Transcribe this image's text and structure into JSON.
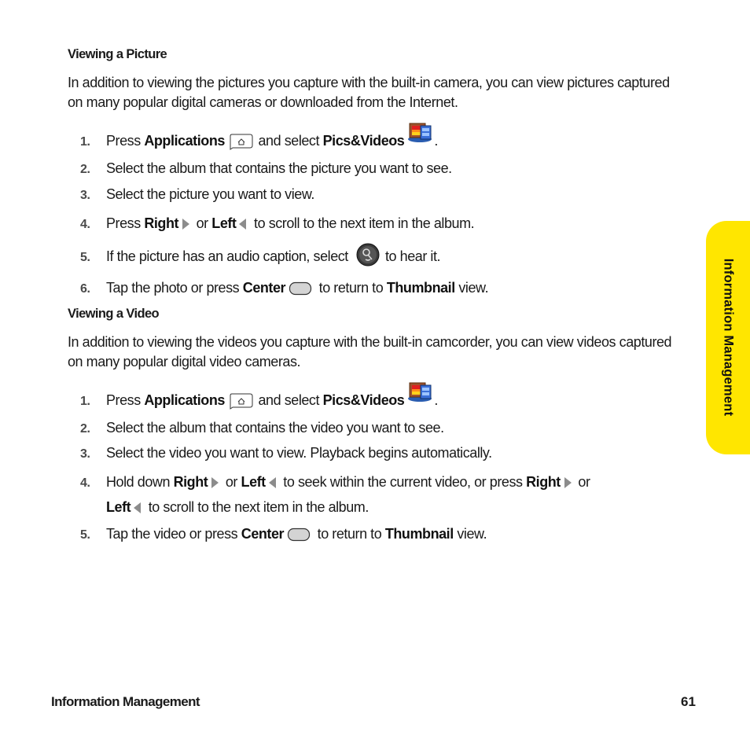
{
  "section_picture": {
    "title": "Viewing a Picture",
    "intro": "In addition to viewing the pictures you capture with the built-in camera, you can view pictures captured on many popular digital cameras or downloaded from the Internet.",
    "steps": [
      {
        "num": "1.",
        "t1": "Press ",
        "b1": "Applications",
        "t2": " and select ",
        "b2": "Pics&Videos",
        "t3": "."
      },
      {
        "num": "2.",
        "text": "Select the album that contains the picture you want to see."
      },
      {
        "num": "3.",
        "text": "Select the picture you want to view."
      },
      {
        "num": "4.",
        "t1": "Press ",
        "b1": "Right",
        "t2": " or ",
        "b2": "Left",
        "t3": " to scroll to the next item in the album."
      },
      {
        "num": "5.",
        "t1": "If the picture has an audio caption, select ",
        "t2": " to hear it."
      },
      {
        "num": "6.",
        "t1": "Tap the photo or press ",
        "b1": "Center",
        "t2": " to return to ",
        "b2": "Thumbnail",
        "t3": " view."
      }
    ]
  },
  "section_video": {
    "title": "Viewing a Video",
    "intro": "In addition to viewing the videos you capture with the built-in camcorder, you can view videos captured on many popular digital video cameras.",
    "steps": [
      {
        "num": "1.",
        "t1": "Press ",
        "b1": "Applications",
        "t2": " and select ",
        "b2": "Pics&Videos",
        "t3": "."
      },
      {
        "num": "2.",
        "text": "Select the album that contains the video you want to see."
      },
      {
        "num": "3.",
        "text": "Select the video you want to view. Playback begins automatically."
      },
      {
        "num": "4.",
        "t1": "Hold down ",
        "b1": "Right",
        "t2": " or ",
        "b2": "Left",
        "t3": " to seek within the current video, or press ",
        "b3": "Right",
        "t4": " or",
        "b4": "Left",
        "t5": " to scroll to the next item in the album."
      },
      {
        "num": "5.",
        "t1": "Tap the video or press ",
        "b1": "Center",
        "t2": " to return to ",
        "b2": "Thumbnail",
        "t3": " view."
      }
    ]
  },
  "side_tab": {
    "label": "Information Management",
    "color": "#ffe600"
  },
  "footer": {
    "section": "Information Management",
    "page": "61"
  },
  "icons": {
    "applications": "applications-key-icon",
    "pics_videos": "pics-videos-app-icon",
    "right": "right-arrow-icon",
    "left": "left-arrow-icon",
    "audio": "audio-caption-icon",
    "center": "center-key-icon"
  }
}
